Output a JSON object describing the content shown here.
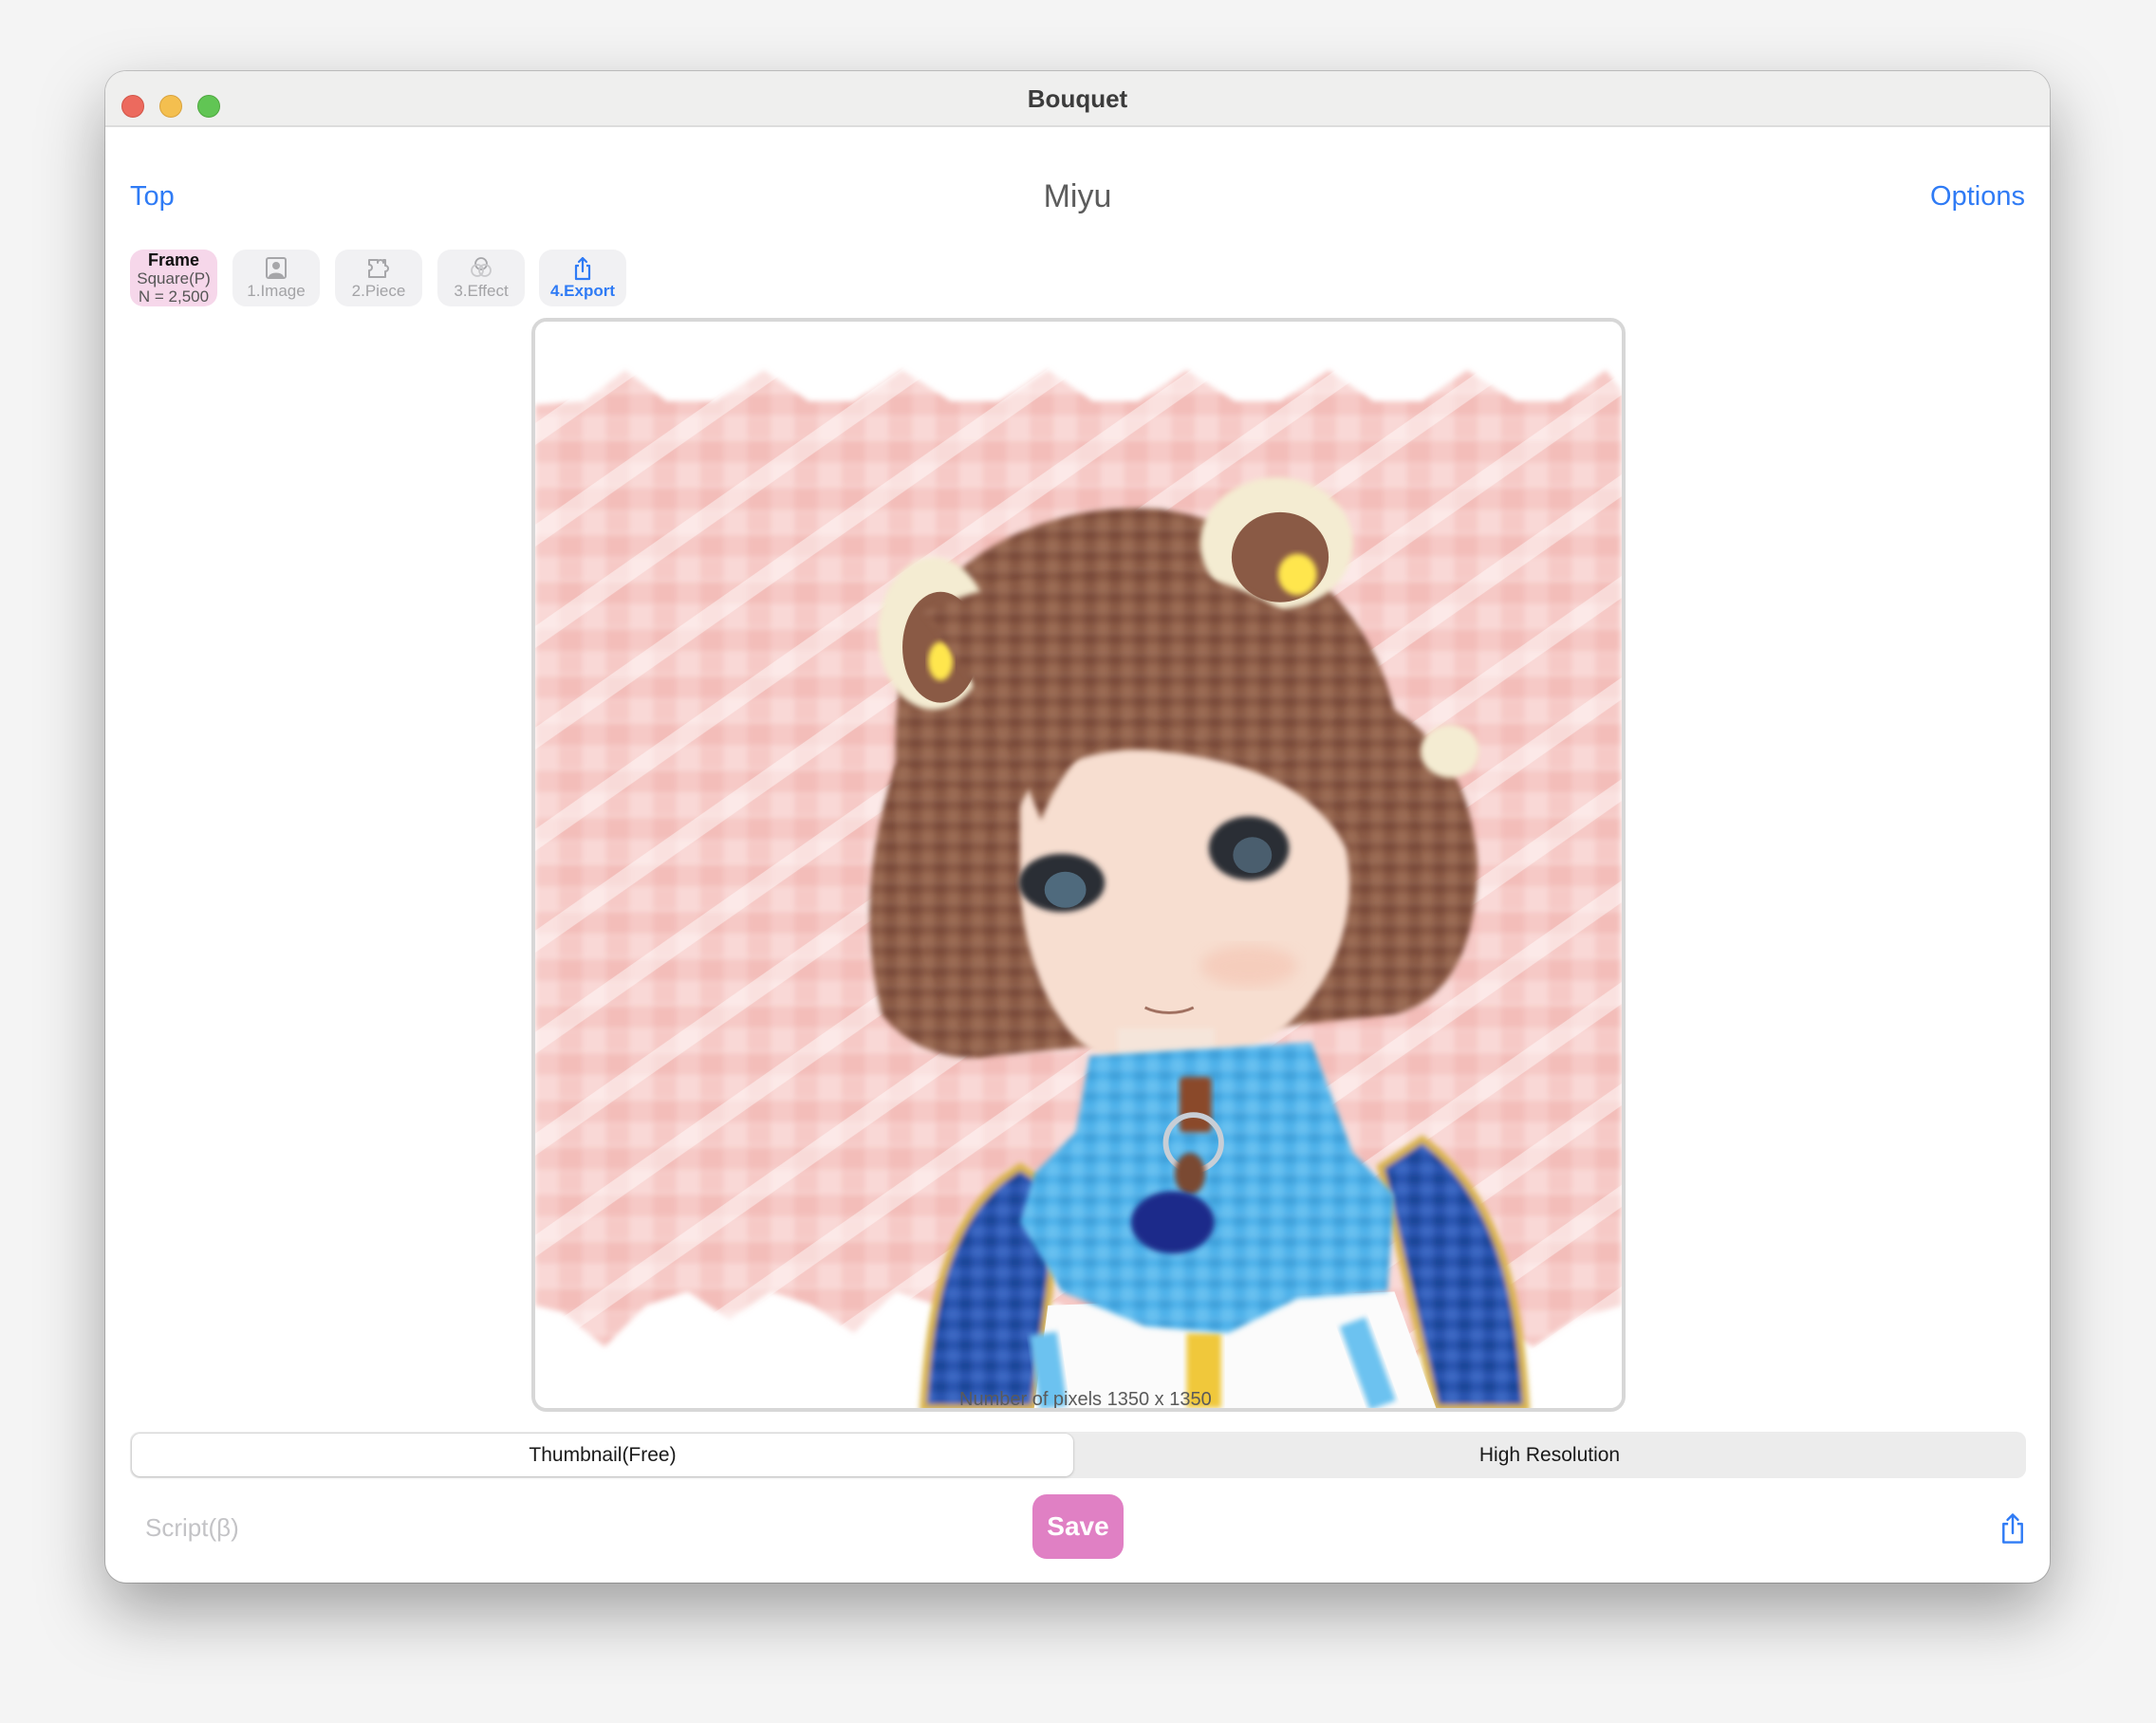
{
  "window": {
    "title": "Bouquet",
    "traffic_lights": [
      "close",
      "minimize",
      "zoom"
    ]
  },
  "nav": {
    "back_label": "Top",
    "document_title": "Miyu",
    "options_label": "Options"
  },
  "steps": {
    "frame": {
      "title": "Frame",
      "shape": "Square(P)",
      "count": "N = 2,500"
    },
    "items": [
      {
        "label": "1.Image",
        "icon": "person-photo-icon",
        "active": false
      },
      {
        "label": "2.Piece",
        "icon": "puzzle-piece-icon",
        "active": false
      },
      {
        "label": "3.Effect",
        "icon": "overlapping-circles-icon",
        "active": false
      },
      {
        "label": "4.Export",
        "icon": "share-icon",
        "active": true
      }
    ]
  },
  "preview": {
    "image_description": "Photomosaic of anime girl with brown hair, bear ears and blue outfit on pink background",
    "pixels_note": "Number of pixels 1350 x 1350"
  },
  "resolution": {
    "options": [
      "Thumbnail(Free)",
      "High Resolution"
    ],
    "selected": "Thumbnail(Free)"
  },
  "footer": {
    "script_label": "Script(β)",
    "save_label": "Save",
    "share_icon": "share-icon"
  },
  "colors": {
    "accent_blue": "#2f7bf5",
    "save_pink": "#e080c4",
    "frame_pink": "#f6d7ea",
    "mosaic_background": "#f6c9c6"
  }
}
